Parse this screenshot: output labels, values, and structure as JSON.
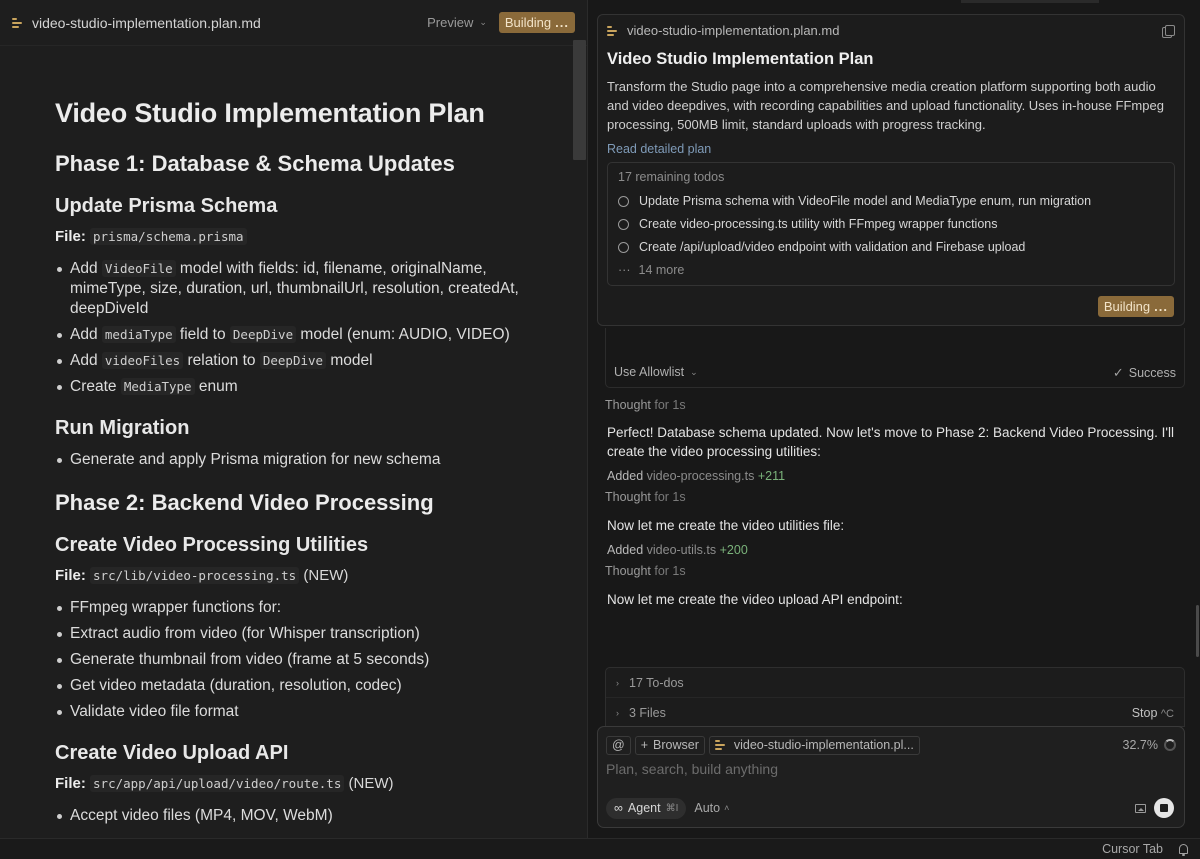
{
  "editor": {
    "tab_name": "video-studio-implementation.plan.md",
    "preview_label": "Preview",
    "building_label": "Building",
    "doc": {
      "h1": "Video Studio Implementation Plan",
      "phase1": {
        "title": "Phase 1: Database & Schema Updates",
        "sec1": {
          "title": "Update Prisma Schema",
          "file_label": "File:",
          "file_path": "prisma/schema.prisma",
          "items": [
            {
              "pre": "Add ",
              "code": "VideoFile",
              "post": " model with fields: id, filename, originalName, mimeType, size, duration, url, thumbnailUrl, resolution, createdAt, deepDiveId"
            },
            {
              "pre": "Add ",
              "code": "mediaType",
              "mid": " field to ",
              "code2": "DeepDive",
              "post": " model (enum: AUDIO, VIDEO)"
            },
            {
              "pre": "Add ",
              "code": "videoFiles",
              "mid": " relation to ",
              "code2": "DeepDive",
              "post": " model"
            },
            {
              "pre": "Create ",
              "code": "MediaType",
              "post": " enum"
            }
          ]
        },
        "sec2": {
          "title": "Run Migration",
          "items": [
            "Generate and apply Prisma migration for new schema"
          ]
        }
      },
      "phase2": {
        "title": "Phase 2: Backend Video Processing",
        "sec1": {
          "title": "Create Video Processing Utilities",
          "file_label": "File:",
          "file_path": "src/lib/video-processing.ts",
          "file_suffix": " (NEW)",
          "items": [
            "FFmpeg wrapper functions for:",
            "Extract audio from video (for Whisper transcription)",
            "Generate thumbnail from video (frame at 5 seconds)",
            "Get video metadata (duration, resolution, codec)",
            "Validate video file format"
          ]
        },
        "sec2": {
          "title": "Create Video Upload API",
          "file_label": "File:",
          "file_path": "src/app/api/upload/video/route.ts",
          "file_suffix": " (NEW)",
          "items": [
            "Accept video files (MP4, MOV, WebM)"
          ]
        }
      }
    }
  },
  "plan_card": {
    "file_name": "video-studio-implementation.plan.md",
    "title": "Video Studio Implementation Plan",
    "description": "Transform the Studio page into a comprehensive media creation platform supporting both audio and video deepdives, with recording capabilities and upload functionality. Uses in-house FFmpeg processing, 500MB limit, standard uploads with progress tracking.",
    "link_label": "Read detailed plan",
    "todos_count": "17 remaining todos",
    "todos": [
      "Update Prisma schema with VideoFile model and MediaType enum, run migration",
      "Create video-processing.ts utility with FFmpeg wrapper functions",
      "Create /api/upload/video endpoint with validation and Firebase upload"
    ],
    "more_label": "14 more",
    "building_label": "Building"
  },
  "tool_call": {
    "allowlist_label": "Use Allowlist",
    "status": "Success"
  },
  "chat": {
    "thought1": {
      "label": "Thought",
      "duration": "for 1s"
    },
    "msg1": "Perfect! Database schema updated. Now let's move to Phase 2: Backend Video Processing. I'll create the video processing utilities:",
    "added1": {
      "label": "Added",
      "file": "video-processing.ts",
      "lines": "+211"
    },
    "thought2": {
      "label": "Thought",
      "duration": "for 1s"
    },
    "msg2": "Now let me create the video utilities file:",
    "added2": {
      "label": "Added",
      "file": "video-utils.ts",
      "lines": "+200"
    },
    "thought3": {
      "label": "Thought",
      "duration": "for 1s"
    },
    "msg3": "Now let me create the video upload API endpoint:"
  },
  "composer": {
    "todos_label": "17 To-dos",
    "files_label": "3 Files",
    "stop_label": "Stop",
    "stop_key": "^C",
    "at_label": "@",
    "browser_label": "Browser",
    "context_chip": "video-studio-implementation.pl...",
    "context_pct": "32.7%",
    "placeholder": "Plan, search, build anything",
    "agent_label": "Agent",
    "agent_kbd": "⌘I",
    "model_label": "Auto"
  },
  "statusbar": {
    "cursor_tab": "Cursor Tab"
  }
}
